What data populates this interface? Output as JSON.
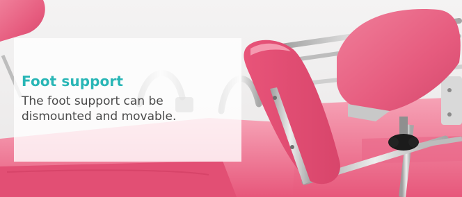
{
  "banner": {
    "title": "Foot support",
    "description_line1": "The foot support can be",
    "description_line2": "dismounted and movable."
  },
  "colors": {
    "title_accent": "#29b6b6",
    "body_text": "#4a4a4a",
    "upholstery_pink": "#e95a7d",
    "upholstery_pink_light": "#f38aa2",
    "steel": "#c9c9c9",
    "knob": "#1a1a1a"
  }
}
